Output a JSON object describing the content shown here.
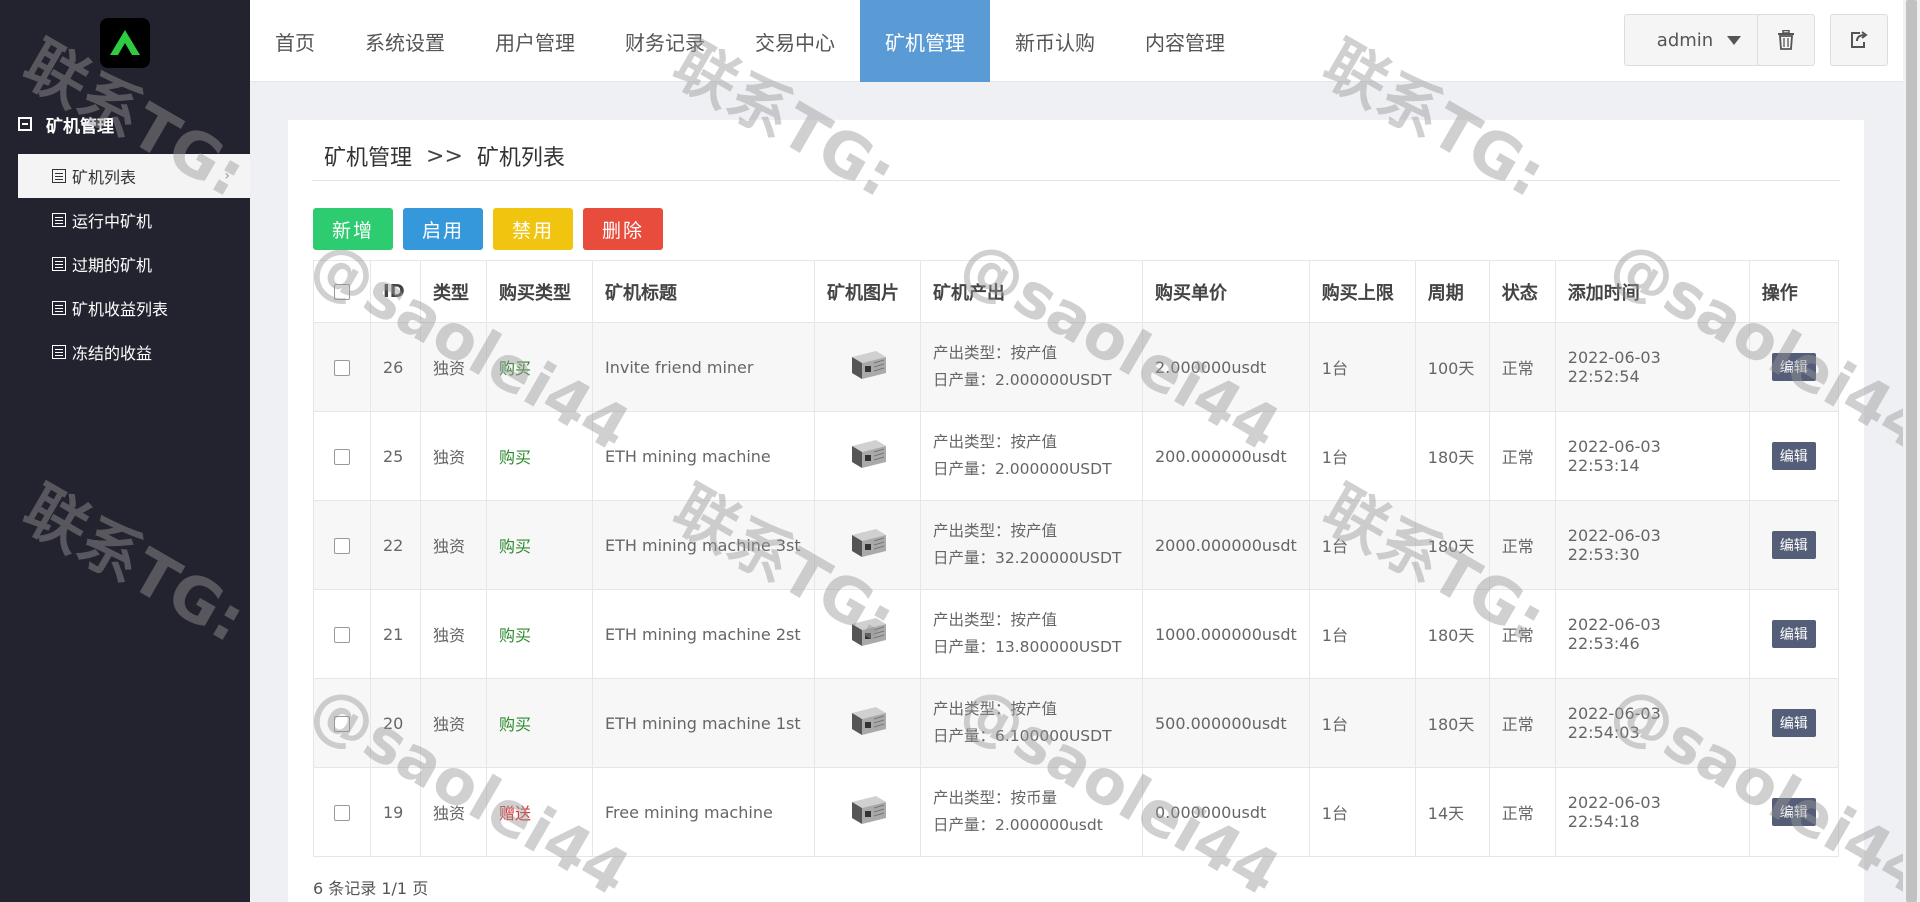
{
  "sidebar": {
    "section_title": "矿机管理",
    "items": [
      {
        "label": "矿机列表",
        "active": true
      },
      {
        "label": "运行中矿机",
        "active": false
      },
      {
        "label": "过期的矿机",
        "active": false
      },
      {
        "label": "矿机收益列表",
        "active": false
      },
      {
        "label": "冻结的收益",
        "active": false
      }
    ]
  },
  "topnav": {
    "items": [
      {
        "label": "首页"
      },
      {
        "label": "系统设置"
      },
      {
        "label": "用户管理"
      },
      {
        "label": "财务记录"
      },
      {
        "label": "交易中心"
      },
      {
        "label": "矿机管理",
        "active": true
      },
      {
        "label": "新币认购"
      },
      {
        "label": "内容管理"
      }
    ],
    "user": "admin"
  },
  "breadcrumb": {
    "root": "矿机管理",
    "sep": ">>",
    "current": "矿机列表"
  },
  "toolbar": {
    "add": "新增",
    "enable": "启用",
    "disable": "禁用",
    "delete": "删除"
  },
  "table": {
    "headers": [
      "ID",
      "类型",
      "购买类型",
      "矿机标题",
      "矿机图片",
      "矿机产出",
      "购买单价",
      "购买上限",
      "周期",
      "状态",
      "添加时间",
      "操作"
    ],
    "rows": [
      {
        "id": "26",
        "type": "独资",
        "buy_type": "购买",
        "buy_color": "green",
        "title": "Invite friend miner",
        "out_type": "产出类型：按产值",
        "out_daily": "日产量：2.000000USDT",
        "price": "2.000000usdt",
        "limit": "1台",
        "cycle": "100天",
        "status": "正常",
        "time": "2022-06-03 22:52:54",
        "edit": "编辑"
      },
      {
        "id": "25",
        "type": "独资",
        "buy_type": "购买",
        "buy_color": "green",
        "title": "ETH mining machine",
        "out_type": "产出类型：按产值",
        "out_daily": "日产量：2.000000USDT",
        "price": "200.000000usdt",
        "limit": "1台",
        "cycle": "180天",
        "status": "正常",
        "time": "2022-06-03 22:53:14",
        "edit": "编辑"
      },
      {
        "id": "22",
        "type": "独资",
        "buy_type": "购买",
        "buy_color": "green",
        "title": "ETH mining machine 3st",
        "out_type": "产出类型：按产值",
        "out_daily": "日产量：32.200000USDT",
        "price": "2000.000000usdt",
        "limit": "1台",
        "cycle": "180天",
        "status": "正常",
        "time": "2022-06-03 22:53:30",
        "edit": "编辑"
      },
      {
        "id": "21",
        "type": "独资",
        "buy_type": "购买",
        "buy_color": "green",
        "title": "ETH mining machine 2st",
        "out_type": "产出类型：按产值",
        "out_daily": "日产量：13.800000USDT",
        "price": "1000.000000usdt",
        "limit": "1台",
        "cycle": "180天",
        "status": "正常",
        "time": "2022-06-03 22:53:46",
        "edit": "编辑"
      },
      {
        "id": "20",
        "type": "独资",
        "buy_type": "购买",
        "buy_color": "green",
        "title": "ETH mining machine 1st",
        "out_type": "产出类型：按产值",
        "out_daily": "日产量：6.100000USDT",
        "price": "500.000000usdt",
        "limit": "1台",
        "cycle": "180天",
        "status": "正常",
        "time": "2022-06-03 22:54:03",
        "edit": "编辑"
      },
      {
        "id": "19",
        "type": "独资",
        "buy_type": "赠送",
        "buy_color": "red",
        "title": "Free mining machine",
        "out_type": "产出类型：按币量",
        "out_daily": "日产量：2.000000usdt",
        "price": "0.000000usdt",
        "limit": "1台",
        "cycle": "14天",
        "status": "正常",
        "time": "2022-06-03 22:54:18",
        "edit": "编辑"
      }
    ]
  },
  "pager": "6 条记录 1/1 页",
  "watermark": {
    "line1": "联系TG:",
    "line2": "@saolei44"
  },
  "colors": {
    "sidebar_bg": "#23232f",
    "nav_active": "#5b9bd5",
    "add": "#2ecc71",
    "enable": "#3498db",
    "disable": "#f1c40f",
    "delete": "#e74c3c",
    "edit": "#555e78",
    "logo_green": "#2ecc40"
  }
}
